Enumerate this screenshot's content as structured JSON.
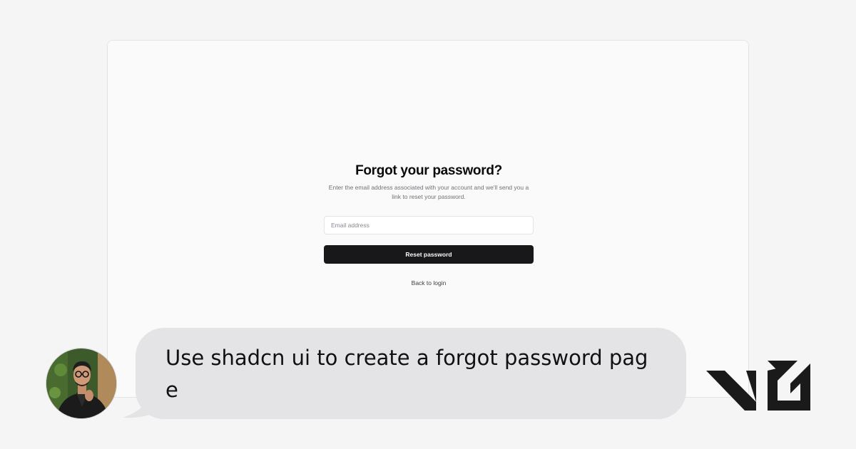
{
  "preview": {
    "title": "Forgot your password?",
    "subtitle": "Enter the email address associated with your account and we'll send you a link to reset your password.",
    "email_input": {
      "placeholder": "Email address",
      "value": ""
    },
    "reset_button_label": "Reset password",
    "back_link_label": "Back to login"
  },
  "chat": {
    "message": "Use shadcn ui to create a forgot password page",
    "avatar_icon": "user-avatar"
  },
  "brand": {
    "logo_icon": "v0-logo"
  },
  "colors": {
    "page_background": "#f5f5f5",
    "preview_background": "#fafafa",
    "primary_button": "#18181b",
    "bubble": "#e4e4e7",
    "logo": "#1a1a1a"
  }
}
